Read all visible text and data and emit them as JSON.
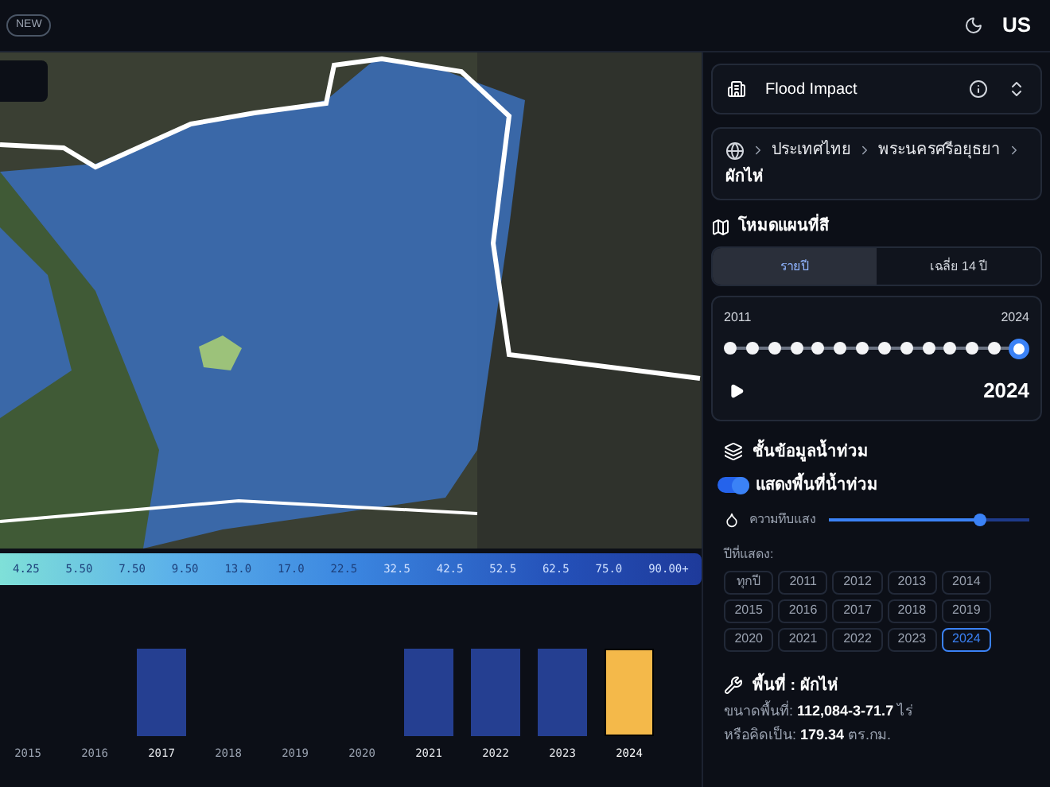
{
  "header": {
    "badge": "NEW",
    "language": "US"
  },
  "legend": {
    "labels": [
      "4.25",
      "5.50",
      "7.50",
      "9.50",
      "13.0",
      "17.0",
      "22.5",
      "32.5",
      "42.5",
      "52.5",
      "62.5",
      "75.0",
      "90.00+"
    ]
  },
  "year_strip": [
    {
      "label": "2015",
      "has_bar": false,
      "selected": false
    },
    {
      "label": "2016",
      "has_bar": false,
      "selected": false
    },
    {
      "label": "2017",
      "has_bar": true,
      "selected": false
    },
    {
      "label": "2018",
      "has_bar": false,
      "selected": false
    },
    {
      "label": "2019",
      "has_bar": false,
      "selected": false
    },
    {
      "label": "2020",
      "has_bar": false,
      "selected": false
    },
    {
      "label": "2021",
      "has_bar": true,
      "selected": false
    },
    {
      "label": "2022",
      "has_bar": true,
      "selected": false
    },
    {
      "label": "2023",
      "has_bar": true,
      "selected": false
    },
    {
      "label": "2024",
      "has_bar": true,
      "selected": true
    }
  ],
  "sidebar": {
    "dataset": "Flood Impact",
    "breadcrumb": [
      "ประเทศไทย",
      "พระนครศรีอยุธยา",
      "ผักไห่"
    ],
    "map_mode_title": "โหมดแผนที่สี",
    "mode_tabs": [
      {
        "label": "รายปี",
        "selected": true
      },
      {
        "label": "เฉลี่ย 14 ปี",
        "selected": false
      }
    ],
    "timeline": {
      "start": "2011",
      "end": "2024",
      "level": 1,
      "current": "2024"
    },
    "layers_title": "ชั้นข้อมูลน้ำท่วม",
    "flood_toggle": {
      "label": "แสดงพื้นที่น้ำท่วม",
      "on": true
    },
    "opacity": {
      "label": "ความทึบแสง",
      "level": 0.75
    },
    "years_label": "ปีที่แสดง:",
    "year_buttons": [
      {
        "label": "ทุกปี",
        "selected": false
      },
      {
        "label": "2011",
        "selected": false
      },
      {
        "label": "2012",
        "selected": false
      },
      {
        "label": "2013",
        "selected": false
      },
      {
        "label": "2014",
        "selected": false
      },
      {
        "label": "2015",
        "selected": false
      },
      {
        "label": "2016",
        "selected": false
      },
      {
        "label": "2017",
        "selected": false
      },
      {
        "label": "2018",
        "selected": false
      },
      {
        "label": "2019",
        "selected": false
      },
      {
        "label": "2020",
        "selected": false
      },
      {
        "label": "2021",
        "selected": false
      },
      {
        "label": "2022",
        "selected": false
      },
      {
        "label": "2023",
        "selected": false
      },
      {
        "label": "2024",
        "selected": true
      }
    ],
    "area_title": "พื้นที่ : ผักไห่",
    "area_lines": [
      "ขนาดพื้นที่: **112,084-3-71.7** ไร่",
      "หรือคิดเป็น: **179.34** ตร.กม."
    ]
  }
}
